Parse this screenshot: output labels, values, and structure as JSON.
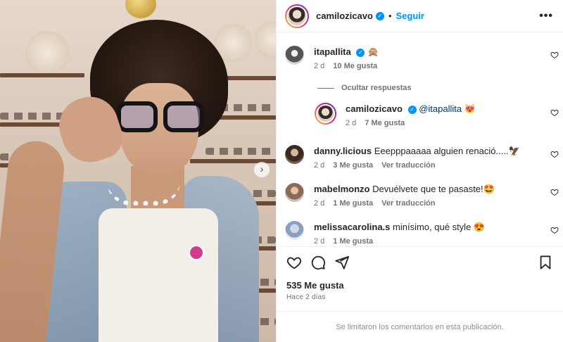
{
  "post": {
    "author": "camilozicavo",
    "separator": "•",
    "follow_label": "Seguir",
    "more_label": "•••",
    "next_image_label": "›"
  },
  "comments": [
    {
      "user": "itapallita",
      "text": "",
      "emoji": "🙊",
      "time": "2 d",
      "likes": "10 Me gusta",
      "translate": ""
    },
    {
      "user": "camilozicavo",
      "text": "@itapallita",
      "emoji": "😻",
      "time": "2 d",
      "likes": "7 Me gusta",
      "translate": ""
    },
    {
      "user": "danny.licious",
      "text": "Eeepppaaaaa alguien renació.....",
      "emoji": "🦅",
      "time": "2 d",
      "likes": "3 Me gusta",
      "translate": "Ver traducción"
    },
    {
      "user": "mabelmonzo",
      "text": "Devuélvete que te pasaste!",
      "emoji": "🤩",
      "time": "2 d",
      "likes": "1 Me gusta",
      "translate": "Ver traducción"
    },
    {
      "user": "melissacarolina.s",
      "text": "minísimo, qué style",
      "emoji": "😍",
      "time": "2 d",
      "likes": "1 Me gusta",
      "translate": ""
    }
  ],
  "hide_replies_label": "Ocultar respuestas",
  "footer": {
    "likes_total": "535 Me gusta",
    "date": "Hace 2 días",
    "limited_notice": "Se limitaron los comentarios en esta publicación."
  },
  "colors": {
    "accent": "#0095f6",
    "text": "#262626",
    "muted": "#737373"
  },
  "icons": [
    "verified-icon",
    "more-options-icon",
    "heart-icon",
    "comment-icon",
    "share-icon",
    "bookmark-icon",
    "chevron-right-icon"
  ]
}
